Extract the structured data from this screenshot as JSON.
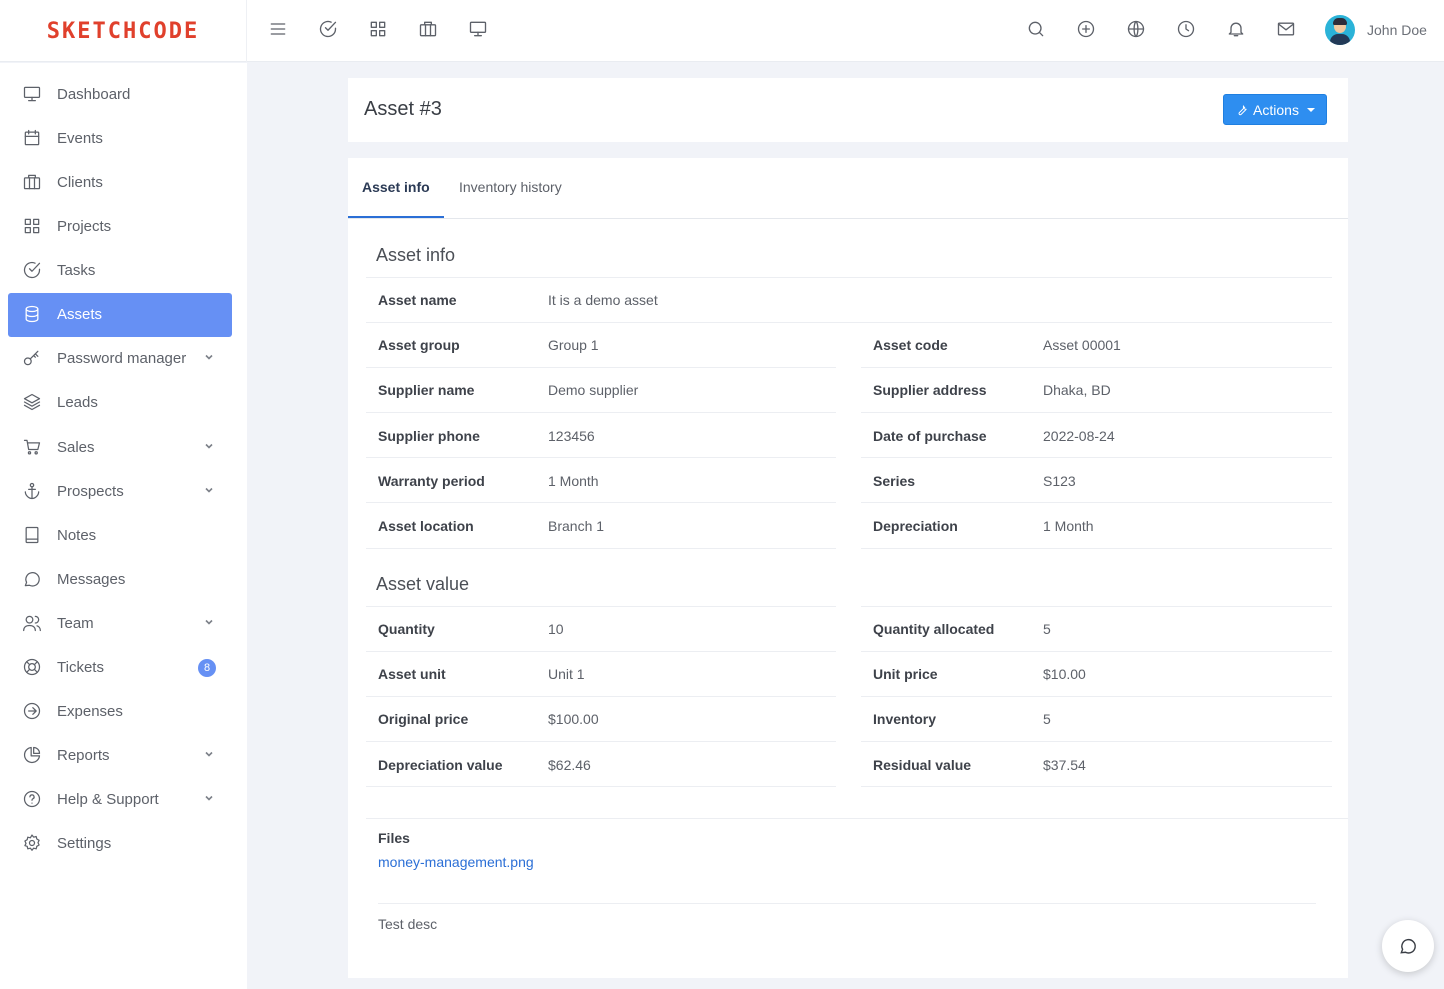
{
  "brand": {
    "logo": "SKETCHCODE"
  },
  "topbar": {
    "left_icons": [
      "menu-icon",
      "check-circle-icon",
      "grid-icon",
      "briefcase-icon",
      "monitor-icon"
    ],
    "right_icons": [
      "search-icon",
      "plus-circle-icon",
      "globe-icon",
      "clock-icon",
      "bell-icon",
      "mail-icon"
    ],
    "user_name": "John Doe"
  },
  "sidebar": {
    "items": [
      {
        "label": "Dashboard",
        "icon": "monitor-icon"
      },
      {
        "label": "Events",
        "icon": "calendar-icon"
      },
      {
        "label": "Clients",
        "icon": "briefcase-icon"
      },
      {
        "label": "Projects",
        "icon": "grid-icon"
      },
      {
        "label": "Tasks",
        "icon": "check-circle-icon"
      },
      {
        "label": "Assets",
        "icon": "database-icon",
        "active": true
      },
      {
        "label": "Password manager",
        "icon": "key-icon",
        "has_children": true
      },
      {
        "label": "Leads",
        "icon": "layers-icon"
      },
      {
        "label": "Sales",
        "icon": "cart-icon",
        "has_children": true
      },
      {
        "label": "Prospects",
        "icon": "anchor-icon",
        "has_children": true
      },
      {
        "label": "Notes",
        "icon": "book-icon"
      },
      {
        "label": "Messages",
        "icon": "message-icon"
      },
      {
        "label": "Team",
        "icon": "users-icon",
        "has_children": true
      },
      {
        "label": "Tickets",
        "icon": "lifebuoy-icon",
        "badge": "8"
      },
      {
        "label": "Expenses",
        "icon": "arrow-circle-icon"
      },
      {
        "label": "Reports",
        "icon": "pie-chart-icon",
        "has_children": true
      },
      {
        "label": "Help & Support",
        "icon": "help-circle-icon",
        "has_children": true
      },
      {
        "label": "Settings",
        "icon": "gear-icon"
      }
    ]
  },
  "page": {
    "title": "Asset #3",
    "actions_label": "Actions",
    "tabs": [
      {
        "label": "Asset info",
        "active": true
      },
      {
        "label": "Inventory history",
        "active": false
      }
    ]
  },
  "asset_info": {
    "section_title": "Asset info",
    "asset_name": {
      "label": "Asset name",
      "value": "It is a demo asset"
    },
    "left": [
      {
        "label": "Asset group",
        "value": "Group 1"
      },
      {
        "label": "Supplier name",
        "value": "Demo supplier"
      },
      {
        "label": "Supplier phone",
        "value": "123456"
      },
      {
        "label": "Warranty period",
        "value": "1 Month"
      },
      {
        "label": "Asset location",
        "value": "Branch 1"
      }
    ],
    "right": [
      {
        "label": "Asset code",
        "value": "Asset 00001"
      },
      {
        "label": "Supplier address",
        "value": "Dhaka, BD"
      },
      {
        "label": "Date of purchase",
        "value": "2022-08-24"
      },
      {
        "label": "Series",
        "value": "S123"
      },
      {
        "label": "Depreciation",
        "value": "1 Month"
      }
    ]
  },
  "asset_value": {
    "section_title": "Asset value",
    "left": [
      {
        "label": "Quantity",
        "value": "10"
      },
      {
        "label": "Asset unit",
        "value": "Unit 1"
      },
      {
        "label": "Original price",
        "value": "$100.00"
      },
      {
        "label": "Depreciation value",
        "value": "$62.46"
      }
    ],
    "right": [
      {
        "label": "Quantity allocated",
        "value": "5"
      },
      {
        "label": "Unit price",
        "value": "$10.00"
      },
      {
        "label": "Inventory",
        "value": "5"
      },
      {
        "label": "Residual value",
        "value": "$37.54"
      }
    ]
  },
  "files": {
    "label": "Files",
    "file_name": "money-management.png",
    "description": "Test desc"
  }
}
